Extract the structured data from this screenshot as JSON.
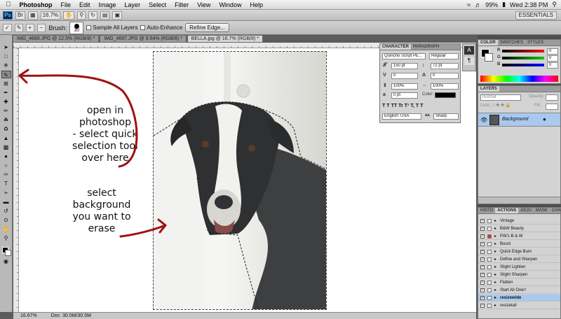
{
  "menubar": {
    "apple": "",
    "app": "Photoshop",
    "items": [
      "File",
      "Edit",
      "Image",
      "Layer",
      "Select",
      "Filter",
      "View",
      "Window",
      "Help"
    ],
    "battery": "99%",
    "clock": "Wed 2:38 PM"
  },
  "appbar": {
    "logo": "Ps",
    "zoom": "16.7%",
    "workspace": "ESSENTIALS"
  },
  "options": {
    "brush_label": "Brush:",
    "brush_size": "30",
    "sample_all_layers": "Sample All Layers",
    "auto_enhance": "Auto-Enhance",
    "refine_edge": "Refine Edge..."
  },
  "tabs": [
    {
      "label": "IMG_4689.JPG @ 12.5% (RGB/8) *",
      "active": false
    },
    {
      "label": "IMG_4697.JPG @ 9.54% (RGB/8) *",
      "active": false
    },
    {
      "label": "BELLA.jpg @ 16.7% (RGB/8) *",
      "active": true
    }
  ],
  "status": {
    "zoom": "16.67%",
    "doc": "Doc: 30.5M/30.5M"
  },
  "character": {
    "tab_character": "CHARACTER",
    "tab_paragraph": "PARAGRAPH",
    "font": "Quincho Script PE...",
    "style": "Regular",
    "size": "150 pt",
    "leading": "72 pt",
    "kerning": "0",
    "tracking": "0",
    "vscale": "100%",
    "hscale": "100%",
    "baseline": "0 pt",
    "color_label": "Color:",
    "styles": [
      "T",
      "T",
      "TT",
      "Tr",
      "T¹",
      "T,",
      "T",
      "T"
    ],
    "language": "English: USA",
    "aa_label": "aa",
    "antialias": "Sharp"
  },
  "color_panel": {
    "tabs": [
      "COLOR",
      "SWATCHES",
      "STYLES"
    ],
    "r": "R",
    "g": "G",
    "b": "B",
    "r_val": "0",
    "g_val": "0",
    "b_val": "0"
  },
  "layers": {
    "title": "LAYERS",
    "mode": "Normal",
    "opacity_label": "Opacity:",
    "lock_label": "Lock:",
    "fill_label": "Fill:",
    "layer_name": "Background"
  },
  "actions": {
    "tabs": [
      "HISTO",
      "ACTIONS",
      "ADJU",
      "MASK",
      "CHAR"
    ],
    "items": [
      "Vintage",
      "B&W Beauty",
      "PW's B & W",
      "Boost",
      "Quick Edge Burn",
      "Define and Sharpen",
      "Slight Lighten",
      "Slight Sharpen",
      "Flatten",
      "Start All Over!",
      "resizewide",
      "resizetall"
    ],
    "selected_index": 10
  },
  "annotations": {
    "note1": [
      "open in",
      "photoshop",
      "- select quick",
      "selection tool",
      "over here"
    ],
    "note2": [
      "select",
      "background",
      "you want to",
      "erase"
    ],
    "arrow_color": "#a01010"
  }
}
